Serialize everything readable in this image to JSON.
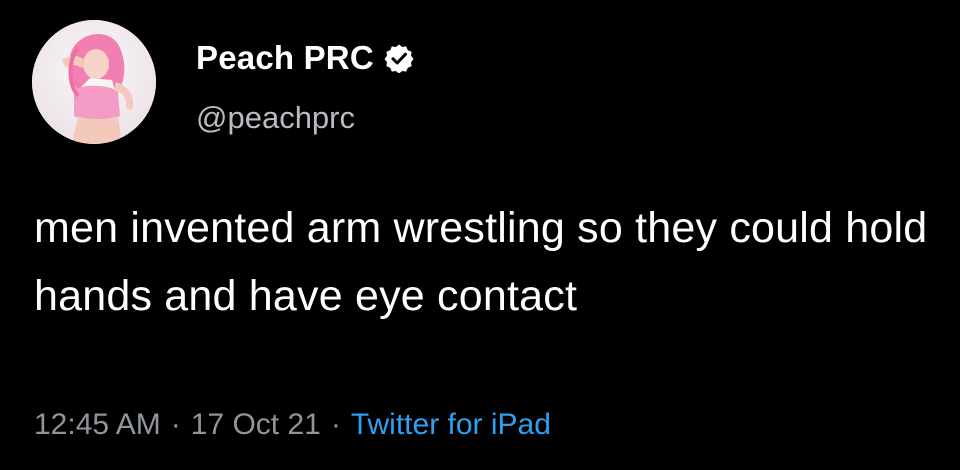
{
  "tweet": {
    "author": {
      "display_name": "Peach PRC",
      "handle": "@peachprc",
      "verified": true,
      "avatar_icon": "profile-photo"
    },
    "text": "men invented arm wrestling so they could hold hands and have eye contact",
    "meta": {
      "time": "12:45 AM",
      "separator": "·",
      "date": "17 Oct 21",
      "source": "Twitter for iPad"
    }
  },
  "colors": {
    "background": "#000000",
    "text_primary": "#ffffff",
    "text_secondary": "#8f959b",
    "link": "#2f9ff0",
    "avatar_hair": "#f27fb2"
  }
}
